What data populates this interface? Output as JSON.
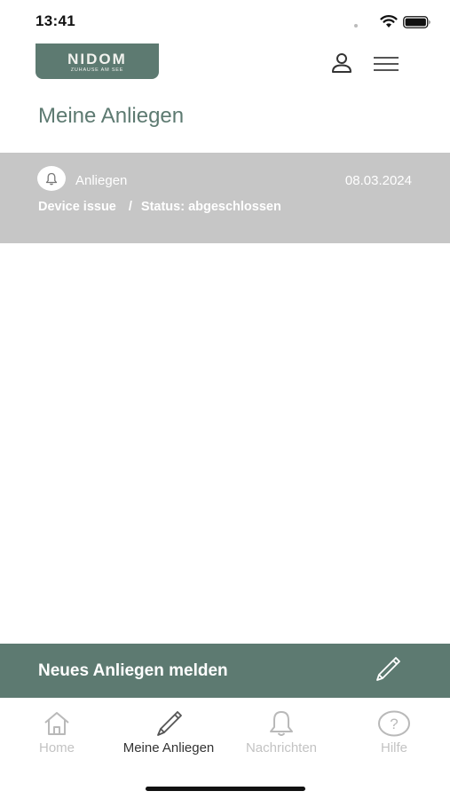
{
  "status_bar": {
    "time": "13:41",
    "icons": [
      "wifi-icon",
      "battery-icon"
    ]
  },
  "header": {
    "logo_text": "NIDOM",
    "logo_subtext": "ZUHAUSE AM SEE",
    "icons": [
      "profile-icon",
      "menu-icon"
    ]
  },
  "page": {
    "title": "Meine Anliegen"
  },
  "requests": [
    {
      "type": "Anliegen",
      "date": "08.03.2024",
      "subject": "Device issue",
      "separator": "/",
      "status": "Status: abgeschlossen",
      "icon": "bell-icon"
    }
  ],
  "new_request": {
    "label": "Neues Anliegen melden",
    "icon": "pencil-icon"
  },
  "tab_bar": {
    "items": [
      {
        "label": "Home",
        "icon": "home-icon",
        "active": false
      },
      {
        "label": "Meine Anliegen",
        "icon": "pencil-icon",
        "active": true
      },
      {
        "label": "Nachrichten",
        "icon": "bell-icon",
        "active": false
      },
      {
        "label": "Hilfe",
        "icon": "help-icon",
        "active": false
      }
    ]
  },
  "colors": {
    "brand": "#5d7a71",
    "card_background": "#c6c6c6",
    "inactive_tab": "#c3c3c3"
  }
}
